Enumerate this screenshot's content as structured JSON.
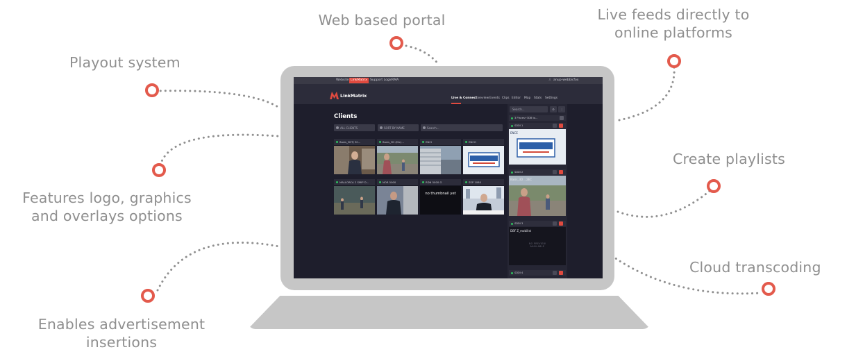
{
  "callouts": {
    "web_portal": "Web based portal",
    "live_feeds_1": "Live feeds directly to",
    "live_feeds_2": "online platforms",
    "playout": "Playout system",
    "features_1": "Features logo, graphics",
    "features_2": "and overlays options",
    "playlists": "Create playlists",
    "transcoding": "Cloud transcoding",
    "ads_1": "Enables advertisement",
    "ads_2": "insertions"
  },
  "colors": {
    "accent": "#e35a4c",
    "laptop": "#c6c6c6",
    "screen_bg": "#1e1e2c",
    "online": "#2fbf5f"
  },
  "app": {
    "topbar": {
      "website": "Website",
      "linkmatrix": "LinkMatrix",
      "support_login": "Support Login",
      "rma": "RMA",
      "user": "anup-webbicfox"
    },
    "brand": "LinkMatrix",
    "nav": [
      "Live & Connect",
      "Liveview",
      "Events",
      "Clips",
      "Editor",
      "Map",
      "Stats",
      "Settings"
    ],
    "page_title": "Clients",
    "filters": {
      "clients": "ALL CLIENTS",
      "sort": "SORT BY NAME",
      "search": "Search..."
    },
    "clients": [
      {
        "name": "Basis_3DTJ 30..."
      },
      {
        "name": "Basis_3D (Dic)..."
      },
      {
        "name": "ENCI"
      },
      {
        "name": "ENCO"
      },
      {
        "name": "MALLORCA 2 SMIP D..."
      },
      {
        "name": "NOR 5000"
      },
      {
        "name": "RDN 5000 G",
        "thumb_text": "no thumbnail yet"
      },
      {
        "name": "SSP 1080"
      }
    ],
    "right_panel": {
      "search": "Search...",
      "playlist": "3 Places+3DB to...",
      "outputs": [
        {
          "name": "SDDI 1",
          "caption": "ENCE"
        },
        {
          "name": "SDDI 2",
          "caption": "Basis_3D ...2EC"
        },
        {
          "name": "SDDI 3",
          "caption": "DBF Z_mobilist",
          "no_preview": "NO PREVIEW AVAILABLE"
        },
        {
          "name": "SDDI 4"
        }
      ]
    }
  }
}
